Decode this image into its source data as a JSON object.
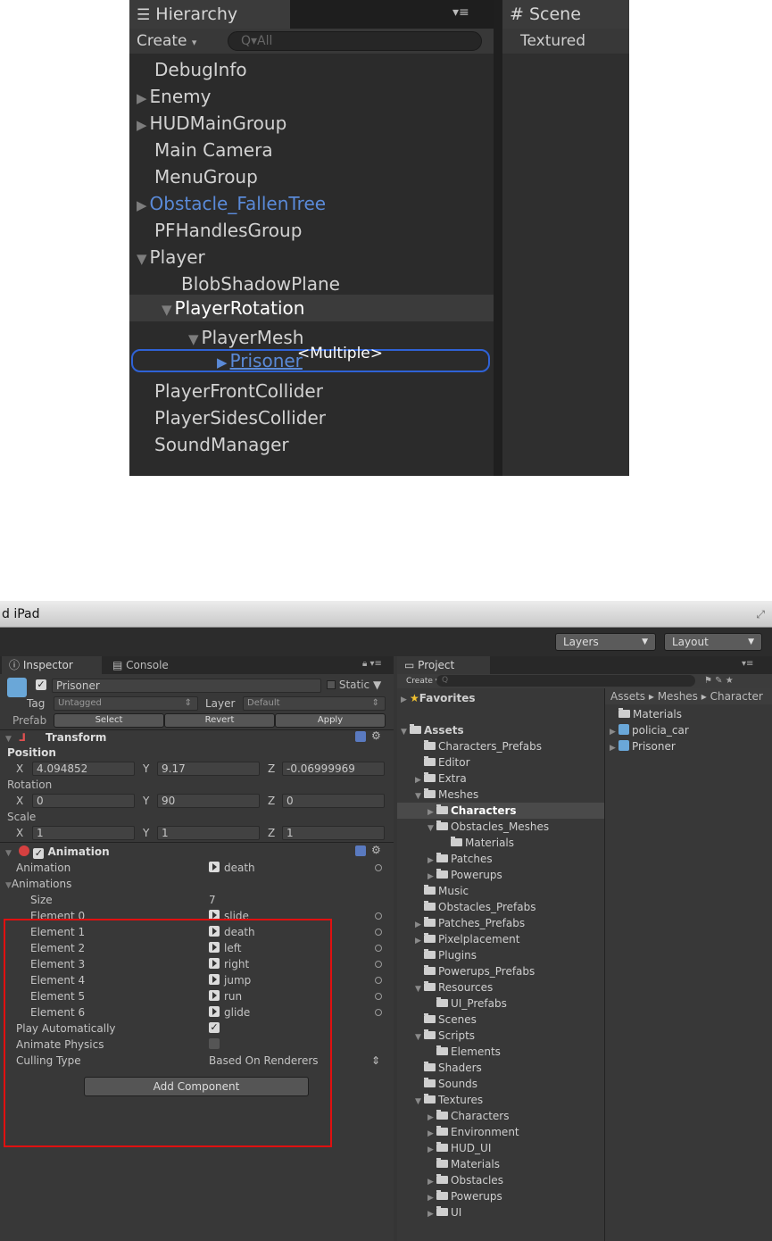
{
  "hierarchy": {
    "tab_label": "Hierarchy",
    "create_label": "Create",
    "search_placeholder": "All",
    "scene_tab_label": "Scene",
    "scene_mode": "Textured",
    "overlay_text": "<Multiple>",
    "items": [
      {
        "label": "DebugInfo"
      },
      {
        "label": "Enemy"
      },
      {
        "label": "HUDMainGroup"
      },
      {
        "label": "Main Camera"
      },
      {
        "label": "MenuGroup"
      },
      {
        "label": "Obstacle_FallenTree"
      },
      {
        "label": "PFHandlesGroup"
      },
      {
        "label": "Player"
      },
      {
        "label": "BlobShadowPlane"
      },
      {
        "label": "PlayerRotation"
      },
      {
        "label": "PlayerMesh"
      },
      {
        "label": "Prisoner"
      },
      {
        "label": "PlayerFrontCollider"
      },
      {
        "label": "PlayerSidesCollider"
      },
      {
        "label": "SoundManager"
      }
    ]
  },
  "window": {
    "title": "d iPad",
    "layers_label": "Layers",
    "layout_label": "Layout"
  },
  "inspector": {
    "tab_label": "Inspector",
    "console_tab_label": "Console",
    "object_name": "Prisoner",
    "static_label": "Static",
    "tag_label": "Tag",
    "tag_value": "Untagged",
    "layer_label": "Layer",
    "layer_value": "Default",
    "prefab_label": "Prefab",
    "prefab_buttons": {
      "select": "Select",
      "revert": "Revert",
      "apply": "Apply"
    },
    "transform": {
      "title": "Transform",
      "position_label": "Position",
      "rotation_label": "Rotation",
      "scale_label": "Scale",
      "position": {
        "x": "4.094852",
        "y": "9.17",
        "z": "-0.06999969"
      },
      "rotation": {
        "x": "0",
        "y": "90",
        "z": "0"
      },
      "scale": {
        "x": "1",
        "y": "1",
        "z": "1"
      },
      "axis": {
        "x": "X",
        "y": "Y",
        "z": "Z"
      }
    },
    "animation": {
      "title": "Animation",
      "animation_label": "Animation",
      "animation_value": "death",
      "animations_label": "Animations",
      "size_label": "Size",
      "size_value": "7",
      "elements": [
        {
          "label": "Element 0",
          "value": "slide"
        },
        {
          "label": "Element 1",
          "value": "death"
        },
        {
          "label": "Element 2",
          "value": "left"
        },
        {
          "label": "Element 3",
          "value": "right"
        },
        {
          "label": "Element 4",
          "value": "jump"
        },
        {
          "label": "Element 5",
          "value": "run"
        },
        {
          "label": "Element 6",
          "value": "glide"
        }
      ],
      "play_auto_label": "Play Automatically",
      "animate_physics_label": "Animate Physics",
      "culling_label": "Culling Type",
      "culling_value": "Based On Renderers",
      "check_mark": "✓"
    },
    "add_component_label": "Add Component"
  },
  "project": {
    "tab_label": "Project",
    "create_label": "Create",
    "favorites_label": "Favorites",
    "assets_label": "Assets",
    "breadcrumb": "Assets ▸ Meshes ▸ Character",
    "tree": [
      "Characters_Prefabs",
      "Editor",
      "Extra",
      "Meshes",
      "Characters",
      "Obstacles_Meshes",
      "Materials",
      "Patches",
      "Powerups",
      "Music",
      "Obstacles_Prefabs",
      "Patches_Prefabs",
      "Pixelplacement",
      "Plugins",
      "Powerups_Prefabs",
      "Resources",
      "UI_Prefabs",
      "Scenes",
      "Scripts",
      "Elements",
      "Shaders",
      "Sounds",
      "Textures",
      "Characters",
      "Environment",
      "HUD_UI",
      "Materials",
      "Obstacles",
      "Powerups",
      "UI"
    ],
    "right_items": [
      "Materials",
      "policia_car",
      "Prisoner"
    ]
  },
  "colors": {
    "selection": "#3b3b3b",
    "prefab_blue": "#5a8ad8",
    "highlight": "#e01010"
  }
}
